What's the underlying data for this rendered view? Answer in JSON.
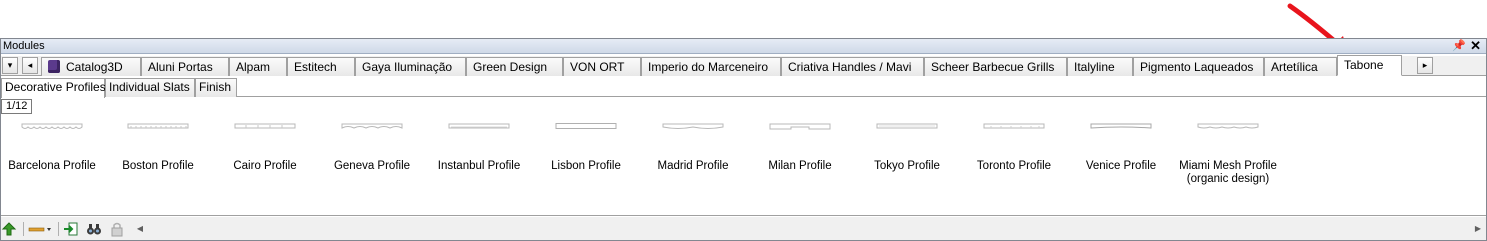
{
  "window": {
    "title": "Modules",
    "pin_glyph": "⭍",
    "close_glyph": "✕"
  },
  "tabs": {
    "nav_down": "▾",
    "nav_left": "◂",
    "nav_right": "▸",
    "items": [
      {
        "label": "Catalog3D",
        "icon": "purple-cube-icon"
      },
      {
        "label": "Aluni Portas"
      },
      {
        "label": "Alpam"
      },
      {
        "label": "Estitech"
      },
      {
        "label": "Gaya Iluminação"
      },
      {
        "label": "Green Design"
      },
      {
        "label": "VON ORT"
      },
      {
        "label": "Imperio do Marceneiro"
      },
      {
        "label": "Criativa Handles / Mavi"
      },
      {
        "label": "Scheer Barbecue Grills"
      },
      {
        "label": "Italyline"
      },
      {
        "label": "Pigmento Laqueados"
      },
      {
        "label": "Artetílica"
      },
      {
        "label": "Tabone",
        "active": true
      }
    ]
  },
  "subtabs": [
    {
      "label": "Decorative Profiles",
      "active": true
    },
    {
      "label": "Individual Slats"
    },
    {
      "label": "Finish"
    }
  ],
  "pager": "1/12",
  "profiles": [
    {
      "label": "Barcelona Profile",
      "icon": "profile-barcelona-icon"
    },
    {
      "label": "Boston Profile",
      "icon": "profile-boston-icon"
    },
    {
      "label": "Cairo Profile",
      "icon": "profile-cairo-icon"
    },
    {
      "label": "Geneva Profile",
      "icon": "profile-geneva-icon"
    },
    {
      "label": "Instanbul Profile",
      "icon": "profile-instanbul-icon"
    },
    {
      "label": "Lisbon Profile",
      "icon": "profile-lisbon-icon"
    },
    {
      "label": "Madrid Profile",
      "icon": "profile-madrid-icon"
    },
    {
      "label": "Milan Profile",
      "icon": "profile-milan-icon"
    },
    {
      "label": "Tokyo Profile",
      "icon": "profile-tokyo-icon"
    },
    {
      "label": "Toronto Profile",
      "icon": "profile-toronto-icon"
    },
    {
      "label": "Venice Profile",
      "icon": "profile-venice-icon"
    },
    {
      "label": "Miami Mesh Profile",
      "label2": "(organic design)",
      "icon": "profile-miami-icon"
    }
  ],
  "toolbar": {
    "icons": [
      "upload-green-icon",
      "line-style-dropdown-icon",
      "import-icon",
      "binoculars-icon",
      "lock-icon"
    ]
  },
  "colors": {
    "annotation_arrow": "#e8141c",
    "cube": "#5b3a8c"
  }
}
